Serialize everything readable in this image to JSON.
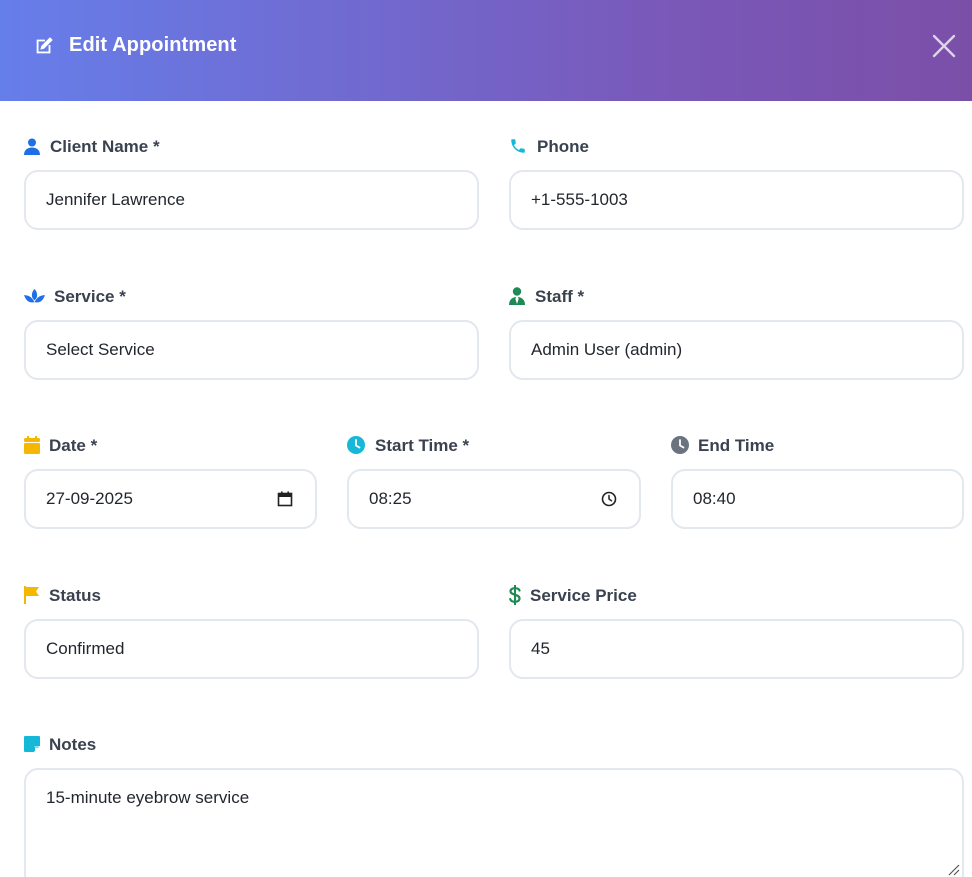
{
  "modal": {
    "title": "Edit Appointment",
    "title_icon": "edit-icon",
    "close_icon": "close-icon"
  },
  "fields": {
    "client_name": {
      "label": "Client Name *",
      "icon": "user-icon",
      "value": "Jennifer Lawrence"
    },
    "phone": {
      "label": "Phone",
      "icon": "phone-icon",
      "value": "+1-555-1003"
    },
    "service": {
      "label": "Service *",
      "icon": "spa-icon",
      "value": "Select Service"
    },
    "staff": {
      "label": "Staff *",
      "icon": "user-tie-icon",
      "value": "Admin User (admin)"
    },
    "date": {
      "label": "Date *",
      "icon": "calendar-icon",
      "value": "27-09-2025"
    },
    "start_time": {
      "label": "Start Time *",
      "icon": "clock-icon",
      "value": "08:25"
    },
    "end_time": {
      "label": "End Time",
      "icon": "clock-icon",
      "value": "08:40"
    },
    "status": {
      "label": "Status",
      "icon": "flag-icon",
      "value": "Confirmed"
    },
    "service_price": {
      "label": "Service Price",
      "icon": "dollar-icon",
      "value": "45"
    },
    "notes": {
      "label": "Notes",
      "icon": "sticky-note-icon",
      "value": "15-minute eyebrow service"
    }
  },
  "colors": {
    "header_gradient_start": "#667eea",
    "header_gradient_end": "#7b4fa8",
    "icon_blue": "#1f6fe5",
    "icon_cyan": "#16b8d8",
    "icon_green": "#1f8a55",
    "icon_yellow": "#f5b800",
    "icon_gray": "#6b7380",
    "field_border": "#e3e7ee"
  }
}
